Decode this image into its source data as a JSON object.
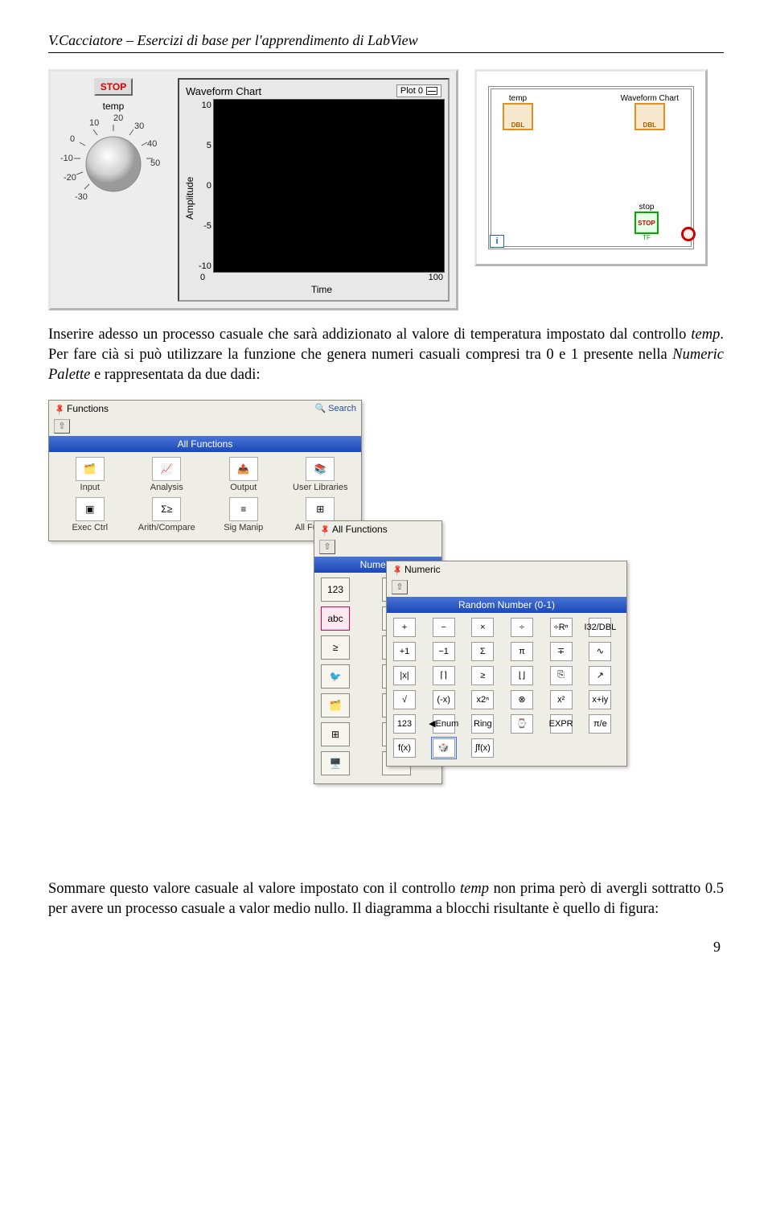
{
  "header": {
    "title": "V.Cacciatore – Esercizi di base per l'apprendimento di LabView"
  },
  "frontpanel": {
    "stop_label": "STOP",
    "temp_label": "temp",
    "knob_ticks": [
      "-30",
      "-20",
      "-10",
      "0",
      "10",
      "20",
      "30",
      "40",
      "50"
    ],
    "chart_title": "Waveform Chart",
    "legend_label": "Plot 0",
    "ylabel": "Amplitude",
    "yticks": [
      "10",
      "5",
      "0",
      "-5",
      "-10"
    ],
    "xticks": [
      "0",
      "100"
    ],
    "xlabel": "Time"
  },
  "blockdiag": {
    "temp_label": "temp",
    "chart_label": "Waveform Chart",
    "stop_label": "stop",
    "stop_btn": "STOP",
    "dbl": "DBL",
    "tf": "TF",
    "i": "i"
  },
  "text": {
    "para1_a": "Inserire adesso un processo casuale che sarà addizionato al valore di temperatura impostato dal controllo ",
    "para1_b": "temp",
    "para1_c": ". Per fare cià si può utilizzare la funzione che genera numeri casuali compresi tra 0 e 1 presente nella ",
    "para1_d": "Numeric Palette",
    "para1_e": " e rappresentata da due dadi:",
    "para2_a": "Sommare questo valore casuale al valore impostato con il controllo ",
    "para2_b": "temp",
    "para2_c": " non prima però di avergli sottratto 0.5 per avere un processo casuale a valor medio nullo. Il diagramma a blocchi risultante è quello di figura:"
  },
  "palettes": {
    "functions": {
      "title": "Functions",
      "search": "Search",
      "bluebar": "All Functions",
      "grid": [
        "Input",
        "Analysis",
        "Output",
        "User Libraries",
        "Exec Ctrl",
        "Arith/Compare",
        "Sig Manip",
        "All Functions"
      ]
    },
    "allfuncs": {
      "title": "All Functions",
      "bluebar": "Numeric"
    },
    "numeric": {
      "title": "Numeric",
      "bluebar": "Random Number (0-1)",
      "grid_row1": [
        "+",
        "−",
        "×",
        "÷",
        "÷Rⁿ",
        "I32/DBL"
      ],
      "grid_row2": [
        "+1",
        "−1",
        "Σ",
        "π",
        "∓",
        "∿"
      ],
      "grid_row3": [
        "|x|",
        "⌈⌉",
        "≥",
        "⌊⌋",
        "⎘",
        "↗"
      ],
      "grid_row4": [
        "√",
        "(-x)",
        "x2ⁿ",
        "⊗",
        "x²",
        "x+iy"
      ],
      "grid_row5": [
        "123",
        "◀Enum",
        "Ring",
        "⌚",
        "EXPR",
        "π/e"
      ],
      "grid_row6": [
        "f(x)",
        "🎲",
        "∫f(x)",
        "",
        "",
        ""
      ]
    }
  },
  "page_number": "9"
}
